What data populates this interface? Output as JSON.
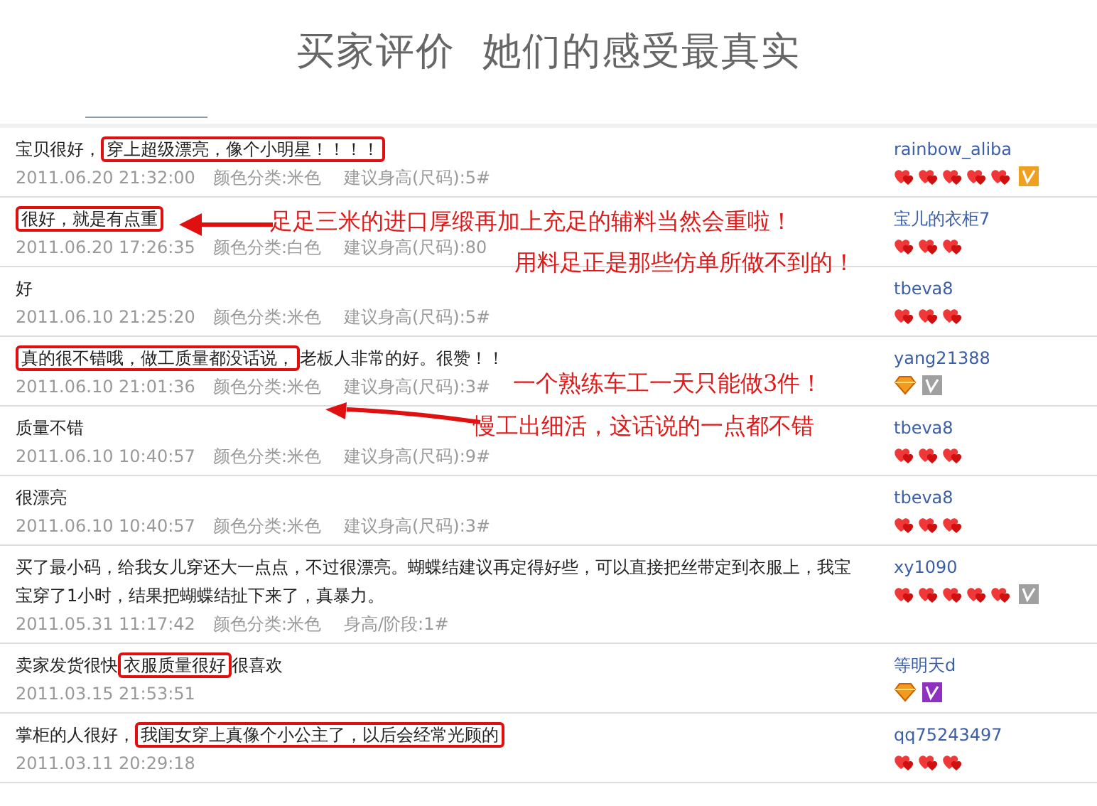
{
  "title": "买家评价  她们的感受最真实",
  "reviews": [
    {
      "comment": [
        {
          "text": "宝贝很好，",
          "boxed": false
        },
        {
          "text": "穿上超级漂亮，像个小明星！！！！",
          "boxed": true
        }
      ],
      "meta": [
        "2011.06.20 21:32:00",
        "颜色分类:米色",
        "建议身高(尺码):5#"
      ],
      "reviewer": "rainbow_aliba",
      "rank": [
        {
          "kind": "heart"
        },
        {
          "kind": "heart"
        },
        {
          "kind": "heart"
        },
        {
          "kind": "heart"
        },
        {
          "kind": "heart"
        }
      ],
      "badge": {
        "color": "#f0a020"
      }
    },
    {
      "comment": [
        {
          "text": "很好，就是有点重",
          "boxed": true
        }
      ],
      "meta": [
        "2011.06.20 17:26:35",
        "颜色分类:白色",
        "建议身高(尺码):80"
      ],
      "reviewer": "宝儿的衣柜7",
      "rank": [
        {
          "kind": "heart"
        },
        {
          "kind": "heart"
        },
        {
          "kind": "heart"
        }
      ]
    },
    {
      "comment": [
        {
          "text": "好",
          "boxed": false
        }
      ],
      "meta": [
        "2011.06.10 21:25:20",
        "颜色分类:米色",
        "建议身高(尺码):5#"
      ],
      "reviewer": "tbeva8",
      "rank": [
        {
          "kind": "heart"
        },
        {
          "kind": "heart"
        },
        {
          "kind": "heart"
        }
      ]
    },
    {
      "comment": [
        {
          "text": "真的很不错哦，做工质量都没话说，",
          "boxed": true
        },
        {
          "text": "老板人非常的好。很赞！！",
          "boxed": false
        }
      ],
      "meta": [
        "2011.06.10 21:01:36",
        "颜色分类:米色",
        "建议身高(尺码):3#"
      ],
      "reviewer": "yang21388",
      "rank": [
        {
          "kind": "diamond"
        }
      ],
      "badge": {
        "color": "#a0a0a0"
      }
    },
    {
      "comment": [
        {
          "text": "质量不错",
          "boxed": false
        }
      ],
      "meta": [
        "2011.06.10 10:40:57",
        "颜色分类:米色",
        "建议身高(尺码):9#"
      ],
      "reviewer": "tbeva8",
      "rank": [
        {
          "kind": "heart"
        },
        {
          "kind": "heart"
        },
        {
          "kind": "heart"
        }
      ]
    },
    {
      "comment": [
        {
          "text": "很漂亮",
          "boxed": false
        }
      ],
      "meta": [
        "2011.06.10 10:40:57",
        "颜色分类:米色",
        "建议身高(尺码):3#"
      ],
      "reviewer": "tbeva8",
      "rank": [
        {
          "kind": "heart"
        },
        {
          "kind": "heart"
        },
        {
          "kind": "heart"
        }
      ]
    },
    {
      "comment": [
        {
          "text": "买了最小码，给我女儿穿还大一点点，不过很漂亮。蝴蝶结建议再定得好些，可以直接把丝带定到衣服上，我宝宝穿了1小时，结果把蝴蝶结扯下来了，真暴力。",
          "boxed": false
        }
      ],
      "meta": [
        "2011.05.31 11:17:42",
        "颜色分类:米色",
        "身高/阶段:1#"
      ],
      "reviewer": "xy1090",
      "rank": [
        {
          "kind": "heart"
        },
        {
          "kind": "heart"
        },
        {
          "kind": "heart"
        },
        {
          "kind": "heart"
        },
        {
          "kind": "heart"
        }
      ],
      "badge": {
        "color": "#a0a0a0"
      }
    },
    {
      "comment": [
        {
          "text": "卖家发货很快",
          "boxed": false
        },
        {
          "text": "衣服质量很好",
          "boxed": true
        },
        {
          "text": "很喜欢",
          "boxed": false
        }
      ],
      "meta": [
        "2011.03.15 21:53:51"
      ],
      "reviewer": "等明天d",
      "rank": [
        {
          "kind": "diamond"
        }
      ],
      "badge": {
        "color": "#9030c0"
      }
    },
    {
      "comment": [
        {
          "text": "掌柜的人很好，",
          "boxed": false
        },
        {
          "text": "我闺女穿上真像个小公主了，以后会经常光顾的",
          "boxed": true
        }
      ],
      "meta": [
        "2011.03.11 20:29:18"
      ],
      "reviewer": "qq75243497",
      "rank": [
        {
          "kind": "heart"
        },
        {
          "kind": "heart"
        },
        {
          "kind": "heart"
        }
      ]
    }
  ],
  "annotations": [
    {
      "lines": [
        "足足三米的进口厚缎再加上充足的辅料当然会重啦！",
        "用料足正是那些仿单所做不到的！"
      ]
    },
    {
      "lines": [
        "一个熟练车工一天只能做3件！",
        "慢工出细活，这话说的一点都不错"
      ]
    }
  ]
}
